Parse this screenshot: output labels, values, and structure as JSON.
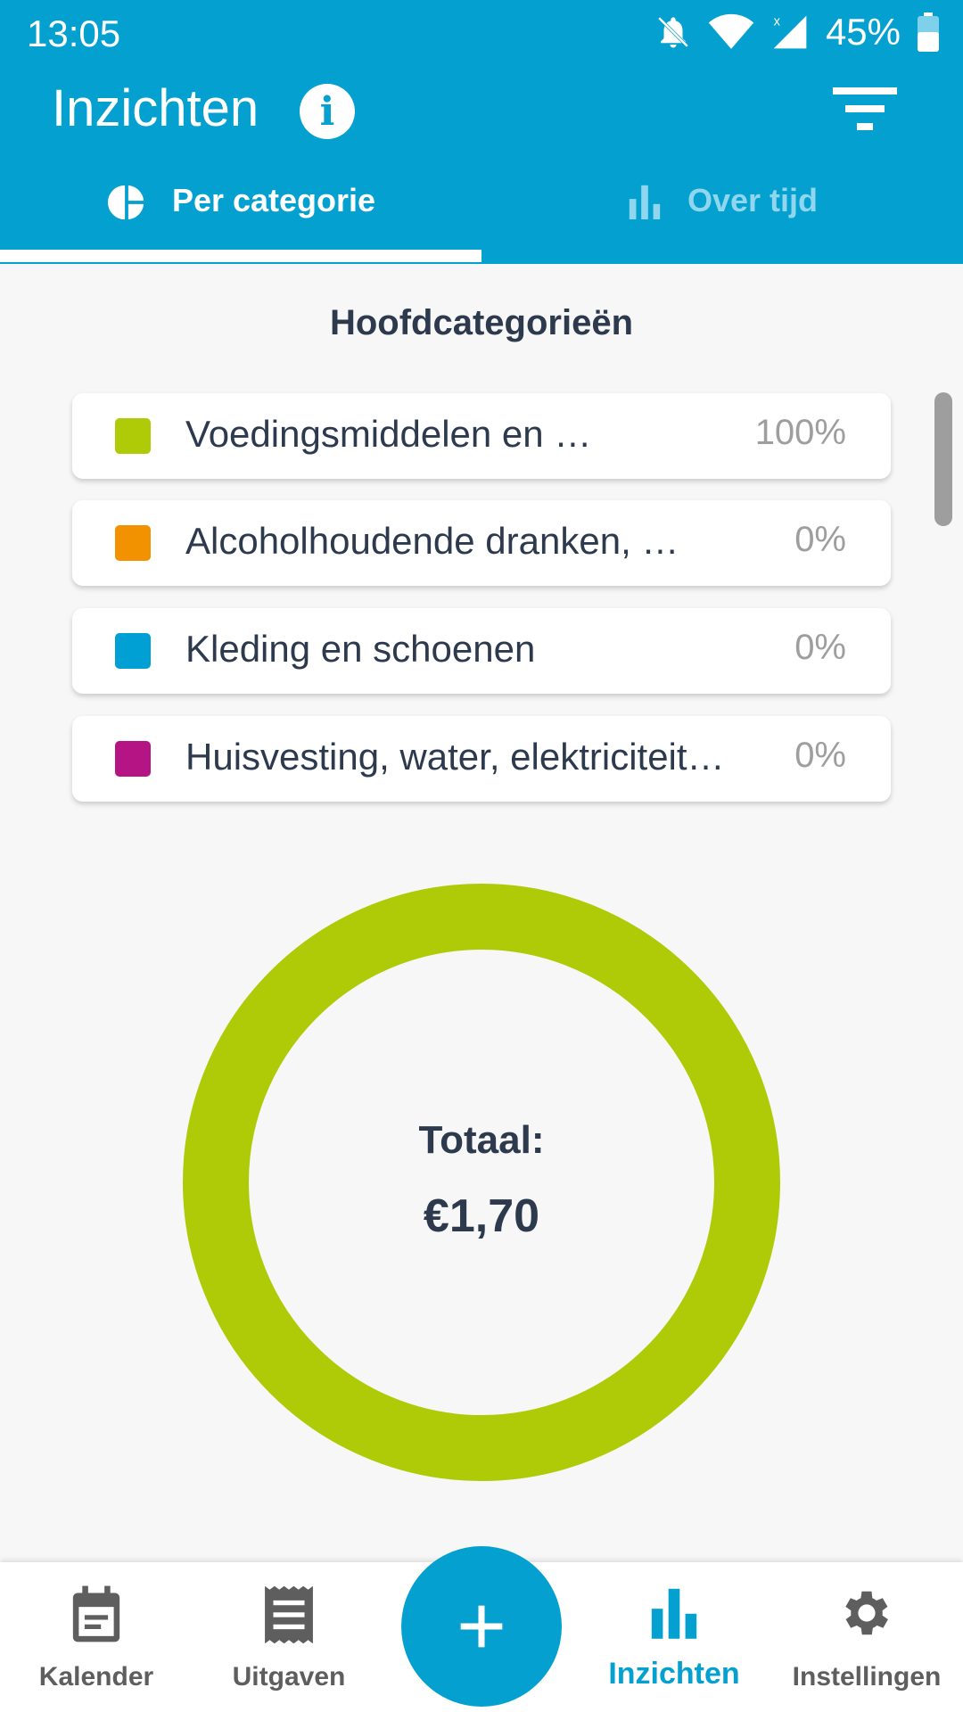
{
  "status_bar": {
    "time": "13:05",
    "battery": "45%"
  },
  "app_bar": {
    "title": "Inzichten",
    "info_icon": "info-icon",
    "filter_icon": "filter-icon"
  },
  "tabs": [
    {
      "label": "Per categorie",
      "icon": "pie-chart-icon",
      "active": true
    },
    {
      "label": "Over tijd",
      "icon": "bar-chart-icon",
      "active": false
    }
  ],
  "section_title": "Hoofdcategorieën",
  "legend": [
    {
      "label": "Voedingsmiddelen en …",
      "percent": "100%",
      "color": "#afcb08"
    },
    {
      "label": "Alcoholhoudende dranken, …",
      "percent": "0%",
      "color": "#f39200"
    },
    {
      "label": "Kleding en schoenen",
      "percent": "0%",
      "color": "#009fd4"
    },
    {
      "label": "Huisvesting, water, elektriciteit…",
      "percent": "0%",
      "color": "#b41484"
    }
  ],
  "donut": {
    "total_label": "Totaal:",
    "total_value": "€1,70",
    "color": "#afcb08"
  },
  "bottom_nav": [
    {
      "label": "Kalender",
      "icon": "calendar-icon"
    },
    {
      "label": "Uitgaven",
      "icon": "receipt-icon"
    },
    {
      "label": "Inzichten",
      "icon": "bar-chart-icon",
      "active": true
    },
    {
      "label": "Instellingen",
      "icon": "gear-icon"
    }
  ],
  "fab": {
    "icon": "plus-icon"
  }
}
